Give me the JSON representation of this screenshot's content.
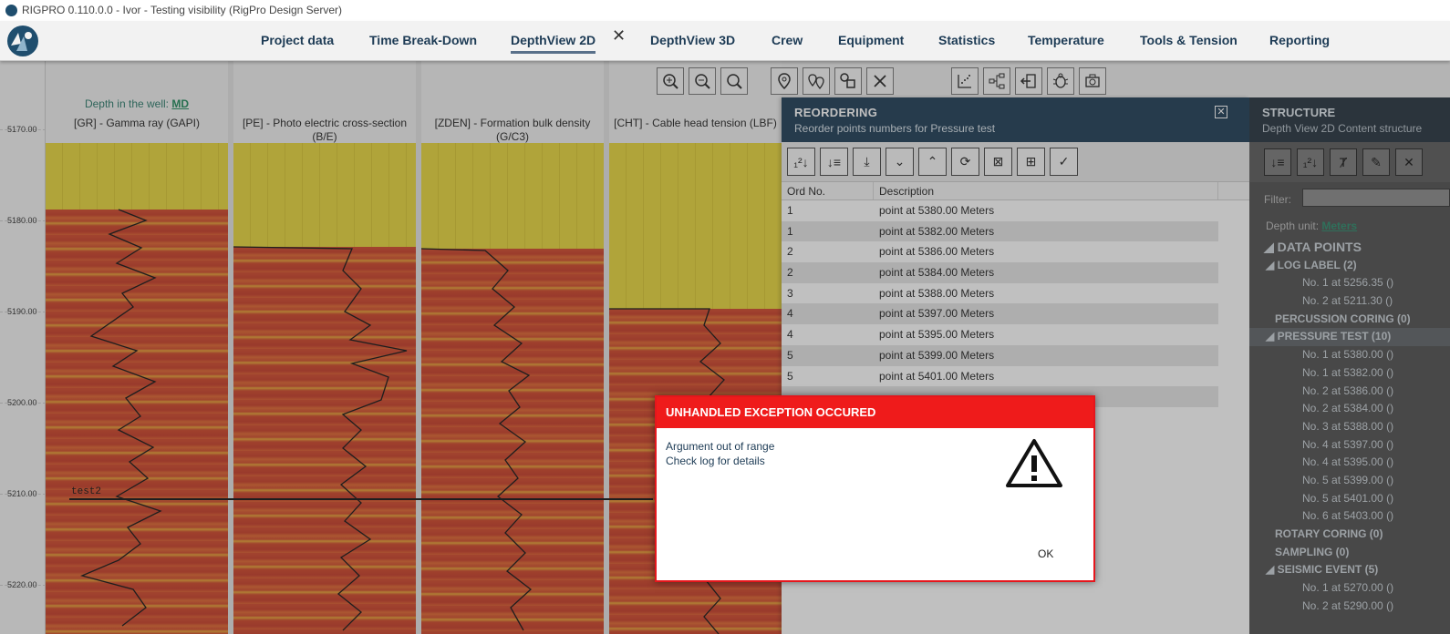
{
  "window": {
    "title": "RIGPRO 0.110.0.0 - Ivor  - Testing visibility  (RigPro Design Server)"
  },
  "nav": {
    "items": [
      "Project data",
      "Time Break-Down",
      "DepthView 2D",
      "DepthView 3D",
      "Crew",
      "Equipment",
      "Statistics",
      "Temperature",
      "Tools & Tension",
      "Reporting"
    ],
    "active": "DepthView 2D",
    "close_glyph": "✕"
  },
  "depthview": {
    "depth_label": "Depth in the well:",
    "depth_mode": "MD",
    "depth_ticks": [
      "5170.00",
      "5180.00",
      "5190.00",
      "5200.00",
      "5210.00",
      "5220.00"
    ],
    "tracks": [
      {
        "title": "[GR] - Gamma ray (GAPI)"
      },
      {
        "title": "[PE] - Photo electric cross-section (B/E)"
      },
      {
        "title": "[ZDEN] - Formation bulk density (G/C3)"
      },
      {
        "title": "[CHT] - Cable head tension (LBF)"
      }
    ],
    "marker_label": "test2"
  },
  "reordering": {
    "title": "REORDERING",
    "subtitle": "Reorder points numbers for Pressure test",
    "close": "✕",
    "columns": [
      "Ord No.",
      "Description"
    ],
    "rows": [
      [
        "1",
        "point at 5380.00 Meters"
      ],
      [
        "1",
        "point at 5382.00 Meters"
      ],
      [
        "2",
        "point at 5386.00 Meters"
      ],
      [
        "2",
        "point at 5384.00 Meters"
      ],
      [
        "3",
        "point at 5388.00 Meters"
      ],
      [
        "4",
        "point at 5397.00 Meters"
      ],
      [
        "4",
        "point at 5395.00 Meters"
      ],
      [
        "5",
        "point at 5399.00 Meters"
      ],
      [
        "5",
        "point at 5401.00 Meters"
      ]
    ]
  },
  "structure": {
    "title": "STRUCTURE",
    "subtitle": "Depth View 2D Content structure",
    "filter_label": "Filter:",
    "depth_unit_label": "Depth unit:",
    "depth_unit_value": "Meters",
    "tree": [
      {
        "label": "◢ DATA POINTS",
        "level": 0
      },
      {
        "label": "◢ LOG LABEL (2)",
        "level": 1
      },
      {
        "label": "No. 1 at 5256.35 ()",
        "level": 2
      },
      {
        "label": "No. 2 at 5211.30 ()",
        "level": 2
      },
      {
        "label": "PERCUSSION CORING (0)",
        "level": 1
      },
      {
        "label": "◢ PRESSURE TEST (10)",
        "level": 1
      },
      {
        "label": "No. 1 at 5380.00 ()",
        "level": 2
      },
      {
        "label": "No. 1 at 5382.00 ()",
        "level": 2
      },
      {
        "label": "No. 2 at 5386.00 ()",
        "level": 2
      },
      {
        "label": "No. 2 at 5384.00 ()",
        "level": 2
      },
      {
        "label": "No. 3 at 5388.00 ()",
        "level": 2
      },
      {
        "label": "No. 4 at 5397.00 ()",
        "level": 2
      },
      {
        "label": "No. 4 at 5395.00 ()",
        "level": 2
      },
      {
        "label": "No. 5 at 5399.00 ()",
        "level": 2
      },
      {
        "label": "No. 5 at 5401.00 ()",
        "level": 2
      },
      {
        "label": "No. 6 at 5403.00 ()",
        "level": 2
      },
      {
        "label": "ROTARY CORING (0)",
        "level": 1
      },
      {
        "label": "SAMPLING (0)",
        "level": 1
      },
      {
        "label": "◢ SEISMIC EVENT (5)",
        "level": 1
      },
      {
        "label": "No. 1 at 5270.00 ()",
        "level": 2
      },
      {
        "label": "No. 2 at 5290.00 ()",
        "level": 2
      }
    ]
  },
  "dialog": {
    "title": "UNHANDLED EXCEPTION OCCURED",
    "line1": "Argument out of range",
    "line2": "Check log for details",
    "ok_label": "OK",
    "icon": "warning-icon"
  },
  "colors": {
    "accent": "#1d3b55",
    "error": "#ef1b1b",
    "track_yellow": "#e8d63a",
    "track_red": "#d2492a"
  }
}
